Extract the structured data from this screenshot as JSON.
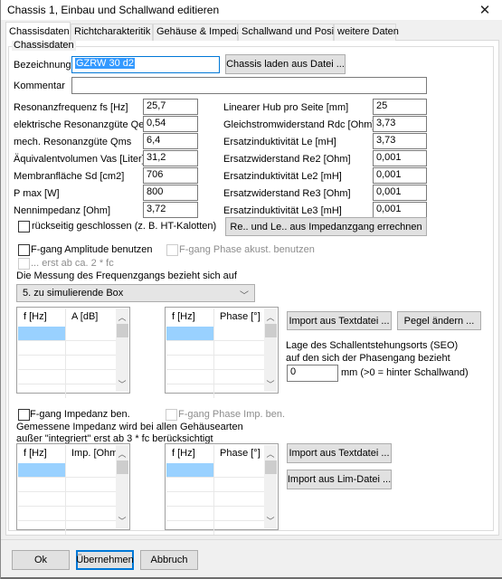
{
  "window": {
    "title": "Chassis 1, Einbau und Schallwand editieren",
    "close_icon": "close-icon"
  },
  "tabs": [
    {
      "label": "Chassisdaten",
      "active": true
    },
    {
      "label": "Richtcharakteritik",
      "active": false
    },
    {
      "label": "Gehäuse & Impedanz",
      "active": false
    },
    {
      "label": "Schallwand und Position",
      "active": false
    },
    {
      "label": "weitere Daten",
      "active": false
    }
  ],
  "group": {
    "title": "Chassisdaten",
    "bezeichnung_label": "Bezeichnung",
    "bezeichnung_value": "GZRW 30 d2",
    "load_button": "Chassis laden aus Datei ...",
    "kommentar_label": "Kommentar",
    "kommentar_value": ""
  },
  "left_params": [
    {
      "label": "Resonanzfrequenz fs [Hz]",
      "value": "25,7"
    },
    {
      "label": "elektrische Resonanzgüte Qes",
      "value": "0,54"
    },
    {
      "label": "mech. Resonanzgüte Qms",
      "value": "6,4"
    },
    {
      "label": "Äquivalentvolumen Vas [Liter]",
      "value": "31,2"
    },
    {
      "label": "Membranfläche Sd [cm2]",
      "value": "706"
    },
    {
      "label": "P max  [W]",
      "value": "800"
    },
    {
      "label": "Nennimpedanz  [Ohm]",
      "value": "3,72"
    }
  ],
  "right_params": [
    {
      "label": "Linearer Hub pro Seite [mm]",
      "value": "25"
    },
    {
      "label": "Gleichstromwiderstand Rdc [Ohm]",
      "value": "3,73"
    },
    {
      "label": "Ersatzinduktivität Le [mH]",
      "value": "3,73"
    },
    {
      "label": "Ersatzwiderstand Re2 [Ohm]",
      "value": "0,001"
    },
    {
      "label": "Ersatzinduktivität Le2 [mH]",
      "value": "0,001"
    },
    {
      "label": "Ersatzwiderstand Re3 [Ohm]",
      "value": "0,001"
    },
    {
      "label": "Ersatzinduktivität Le3 [mH]",
      "value": "0,001"
    }
  ],
  "rueckseitig": {
    "label": "rückseitig geschlossen (z. B. HT-Kalotten)",
    "checked": false
  },
  "compute_button": "Re.. und Le.. aus Impedanzgang errechnen",
  "freq": {
    "amplitude_label": "F-gang Amplitude benutzen",
    "phase_label": "F-gang Phase akust. benutzen",
    "erst_label": "... erst ab ca. 2 * fc",
    "bezug_label": "Die Messung des Frequenzgangs bezieht sich auf",
    "bezug_value": "5. zu simulierende Box",
    "grid_amp": {
      "col1": "f [Hz]",
      "col2": "A [dB]"
    },
    "grid_phase": {
      "col1": "f [Hz]",
      "col2": "Phase [°]"
    },
    "import_button": "Import aus Textdatei ...",
    "pegel_button": "Pegel ändern ...",
    "seo_line1": "Lage des Schallentstehungsorts (SEO)",
    "seo_line2": "auf den sich der Phasengang bezieht",
    "seo_value": "0",
    "seo_unit": "mm  (>0 = hinter Schallwand)"
  },
  "impedance": {
    "impedanz_label": "F-gang Impedanz ben.",
    "phase_label": "F-gang Phase Imp. ben.",
    "note_line1": "Gemessene Impedanz wird bei allen Gehäusearten",
    "note_line2": "außer \"integriert\" erst ab 3 * fc berücksichtigt",
    "grid_imp": {
      "col1": "f [Hz]",
      "col2": "Imp. [Ohm"
    },
    "grid_phase": {
      "col1": "f [Hz]",
      "col2": "Phase [°]"
    },
    "import_text_button": "Import aus Textdatei ...",
    "import_lim_button": "Import aus Lim-Datei ..."
  },
  "footer": {
    "ok": "Ok",
    "apply": "Übernehmen",
    "cancel": "Abbruch"
  }
}
